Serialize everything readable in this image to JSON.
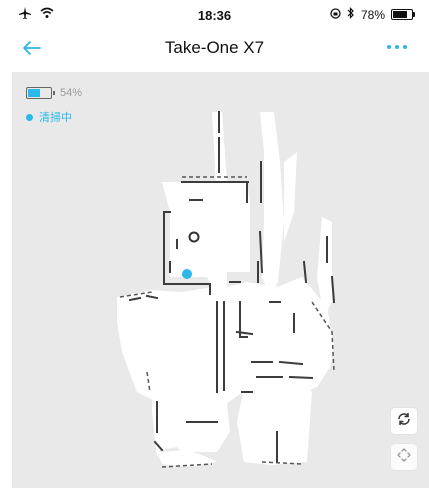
{
  "status_bar": {
    "time": "18:36",
    "battery_percent": "78%",
    "battery_level": 0.78
  },
  "nav": {
    "title": "Take-One X7"
  },
  "device": {
    "battery_text": "54%",
    "battery_level": 0.54,
    "status": "清掃中"
  },
  "colors": {
    "accent": "#2bb8ea",
    "map_background": "#e9e9ea",
    "map_floor": "#ffffff",
    "map_wall": "#3c3c3c"
  }
}
